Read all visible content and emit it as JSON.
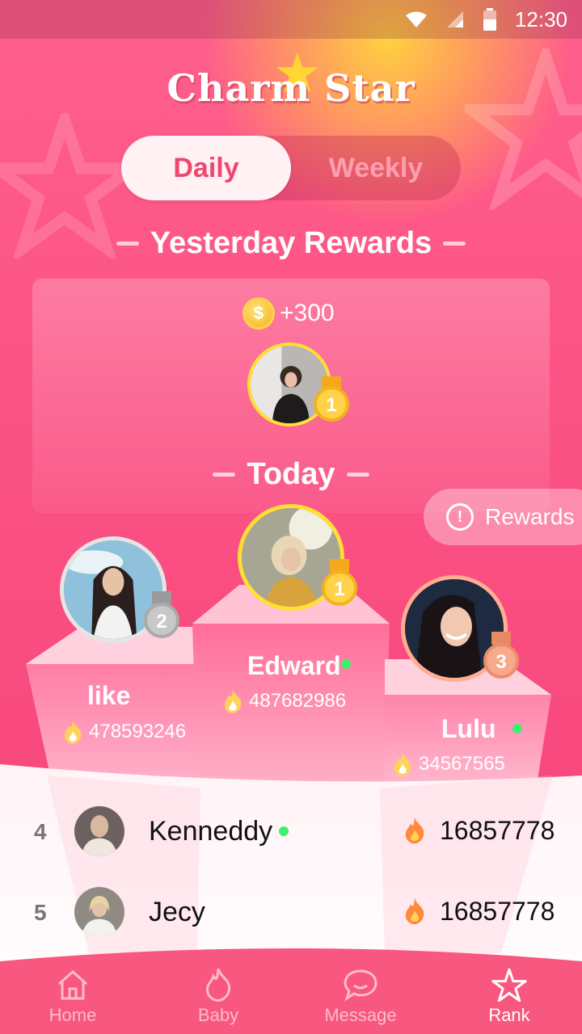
{
  "status_bar": {
    "time": "12:30"
  },
  "header": {
    "title": "Charm Star"
  },
  "tabs": {
    "daily": "Daily",
    "weekly": "Weekly",
    "selected": "Daily"
  },
  "yesterday": {
    "title": "Yesterday Rewards",
    "coin_symbol": "$",
    "reward": "+300",
    "winner_rank": "1"
  },
  "today": {
    "title": "Today"
  },
  "rewards_button": {
    "label": "Rewards",
    "icon": "info-icon"
  },
  "podium": {
    "first": {
      "rank": "1",
      "name": "Edward",
      "score": "487682986",
      "online": true
    },
    "second": {
      "rank": "2",
      "name": "like",
      "score": "478593246",
      "online": false
    },
    "third": {
      "rank": "3",
      "name": "Lulu",
      "score": "34567565",
      "online": true
    }
  },
  "list": [
    {
      "rank": "4",
      "name": "Kenneddy",
      "score": "16857778",
      "online": true
    },
    {
      "rank": "5",
      "name": "Jecy",
      "score": "16857778",
      "online": false
    }
  ],
  "nav": {
    "items": [
      {
        "label": "Home",
        "icon": "home-icon"
      },
      {
        "label": "Baby",
        "icon": "flame-icon"
      },
      {
        "label": "Message",
        "icon": "chat-icon"
      },
      {
        "label": "Rank",
        "icon": "star-icon"
      }
    ],
    "active": "Rank"
  },
  "colors": {
    "accent": "#f0466f",
    "gold": "#f4b21c",
    "online": "#3ff06e",
    "background": "#fb4f84"
  }
}
